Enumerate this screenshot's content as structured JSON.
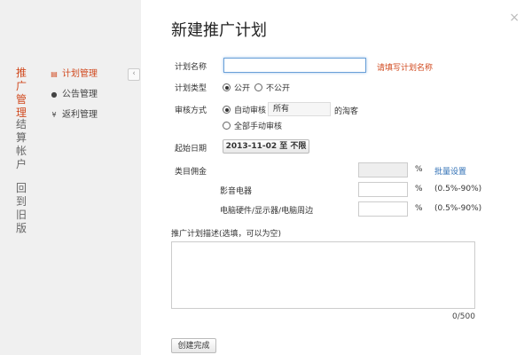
{
  "colors": {
    "accent": "#d14a1f",
    "link": "#2f6fb5"
  },
  "left_tabs": [
    {
      "label": "推广管理",
      "active": true
    },
    {
      "label": "结算帐户",
      "active": false
    },
    {
      "label": "回到旧版",
      "active": false
    }
  ],
  "sub_nav": [
    {
      "icon": "note-icon",
      "label": "计划管理",
      "active": true
    },
    {
      "icon": "chat-bubble-icon",
      "label": "公告管理",
      "active": false
    },
    {
      "icon": "yen-icon",
      "label": "返利管理",
      "active": false
    }
  ],
  "collapse_glyph": "‹",
  "close_glyph": "×",
  "dialog": {
    "title": "新建推广计划",
    "plan_name": {
      "label": "计划名称",
      "value": "",
      "hint": "请填写计划名称"
    },
    "plan_type": {
      "label": "计划类型",
      "options": [
        "公开",
        "不公开"
      ],
      "selected": "公开"
    },
    "review": {
      "label": "审核方式",
      "auto_option": "自动审核",
      "auto_select_value": "所有",
      "auto_suffix": "的淘客",
      "manual_option": "全部手动审核",
      "selected": "自动审核"
    },
    "start_date": {
      "label": "起始日期",
      "button": "2013-11-02 至 不限"
    },
    "commission": {
      "label": "类目佣金",
      "percent_sign": "%",
      "batch_link": "批量设置",
      "rows": [
        {
          "name": "影音电器",
          "value": "",
          "range": "(0.5%-90%)"
        },
        {
          "name": "电脑硬件/显示器/电脑周边",
          "value": "",
          "range": "(0.5%-90%)"
        }
      ]
    },
    "description": {
      "label": "推广计划描述(选填，可以为空)",
      "value": "",
      "counter": "0/500"
    },
    "submit_label": "创建完成"
  }
}
